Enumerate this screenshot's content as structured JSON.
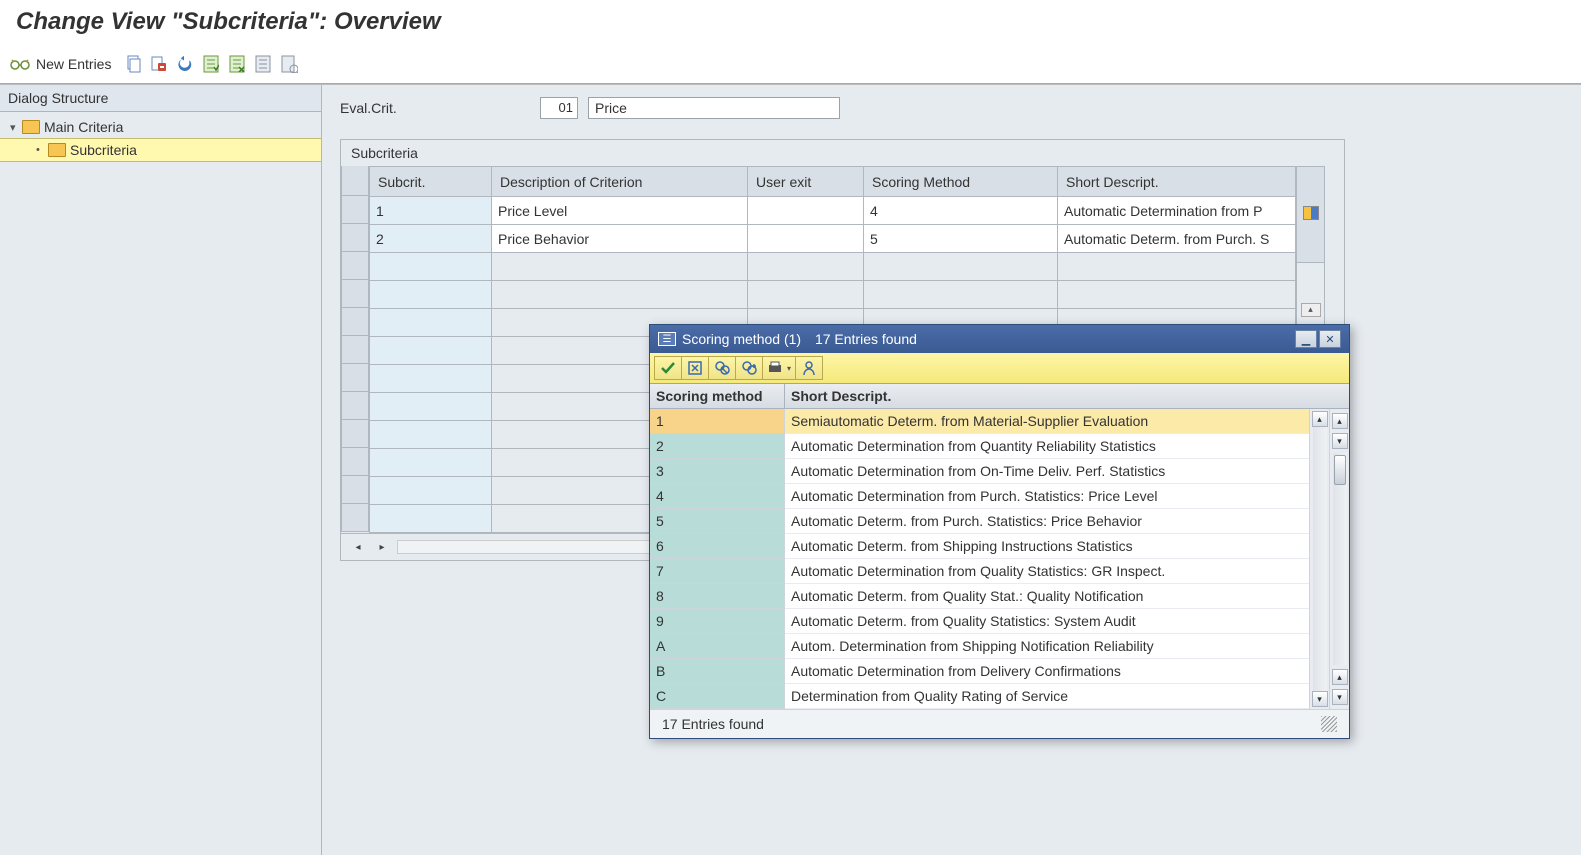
{
  "page_title": "Change View \"Subcriteria\": Overview",
  "toolbar": {
    "new_entries_label": "New Entries"
  },
  "dialog_structure": {
    "header": "Dialog Structure",
    "nodes": [
      {
        "label": "Main Criteria",
        "level": 1,
        "open": true,
        "selected": false
      },
      {
        "label": "Subcriteria",
        "level": 2,
        "open": true,
        "selected": true
      }
    ]
  },
  "eval_crit": {
    "label": "Eval.Crit.",
    "code": "01",
    "name": "Price"
  },
  "subcriteria_group": {
    "title": "Subcriteria",
    "columns": {
      "subcrit": "Subcrit.",
      "desc": "Description of Criterion",
      "user_exit": "User exit",
      "scoring": "Scoring Method",
      "short_desc": "Short Descript."
    },
    "rows": [
      {
        "subcrit": "1",
        "desc": "Price Level",
        "user_exit": "",
        "scoring": "4",
        "short_desc": "Automatic Determination from P"
      },
      {
        "subcrit": "2",
        "desc": "Price Behavior",
        "user_exit": "",
        "scoring": "5",
        "short_desc": "Automatic Determ. from Purch. S"
      }
    ]
  },
  "popup": {
    "title": "Scoring method (1)",
    "entries_found_hdr": "17 Entries found",
    "col_a": "Scoring method",
    "col_b": "Short Descript.",
    "rows": [
      {
        "code": "1",
        "desc": "Semiautomatic Determ. from Material-Supplier Evaluation",
        "selected": true
      },
      {
        "code": "2",
        "desc": "Automatic Determination from Quantity Reliability Statistics",
        "selected": false
      },
      {
        "code": "3",
        "desc": "Automatic Determination from On-Time Deliv. Perf. Statistics",
        "selected": false
      },
      {
        "code": "4",
        "desc": "Automatic Determination from Purch. Statistics: Price Level",
        "selected": false
      },
      {
        "code": "5",
        "desc": "Automatic Determ. from Purch. Statistics: Price Behavior",
        "selected": false
      },
      {
        "code": "6",
        "desc": "Automatic Determ. from Shipping Instructions Statistics",
        "selected": false
      },
      {
        "code": "7",
        "desc": "Automatic Determination from Quality Statistics: GR Inspect.",
        "selected": false
      },
      {
        "code": "8",
        "desc": "Automatic Determ. from Quality Stat.: Quality Notification",
        "selected": false
      },
      {
        "code": "9",
        "desc": "Automatic Determ. from Quality Statistics: System Audit",
        "selected": false
      },
      {
        "code": "A",
        "desc": "Autom. Determination from Shipping Notification Reliability",
        "selected": false
      },
      {
        "code": "B",
        "desc": "Automatic Determination from Delivery Confirmations",
        "selected": false
      },
      {
        "code": "C",
        "desc": "Determination from Quality Rating of Service",
        "selected": false
      }
    ],
    "footer": "17 Entries found"
  }
}
